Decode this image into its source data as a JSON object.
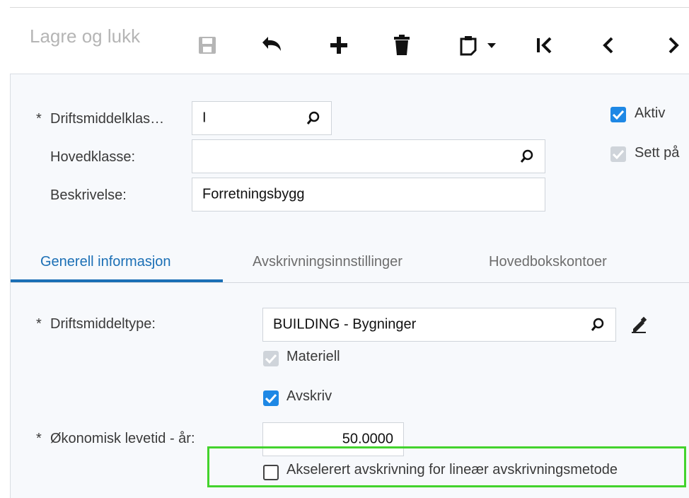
{
  "toolbar": {
    "save_close_label": "Lagre og lukk"
  },
  "form": {
    "class_label": "Driftsmiddelklas…",
    "class_value": "I",
    "parent_class_label": "Hovedklasse:",
    "parent_class_value": "",
    "description_label": "Beskrivelse:",
    "description_value": "Forretningsbygg",
    "active_label": "Aktiv",
    "active_checked": true,
    "set_on_label": "Sett på",
    "required_marker": "*"
  },
  "tabs": [
    {
      "label": "Generell informasjon",
      "active": true
    },
    {
      "label": "Avskrivningsinnstillinger",
      "active": false
    },
    {
      "label": "Hovedbokskontoer",
      "active": false
    }
  ],
  "general": {
    "asset_type_label": "Driftsmiddeltype:",
    "asset_type_value": "BUILDING - Bygninger",
    "material_label": "Materiell",
    "depreciate_label": "Avskriv",
    "useful_life_label": "Økonomisk levetid - år:",
    "useful_life_value": "50.0000",
    "accelerated_label": "Akselerert avskrivning for lineær avskrivningsmetode",
    "accelerated_checked": false
  },
  "colors": {
    "accent": "#1b6fb5",
    "checkbox_on": "#1e88e5",
    "highlight": "#43d32d"
  }
}
